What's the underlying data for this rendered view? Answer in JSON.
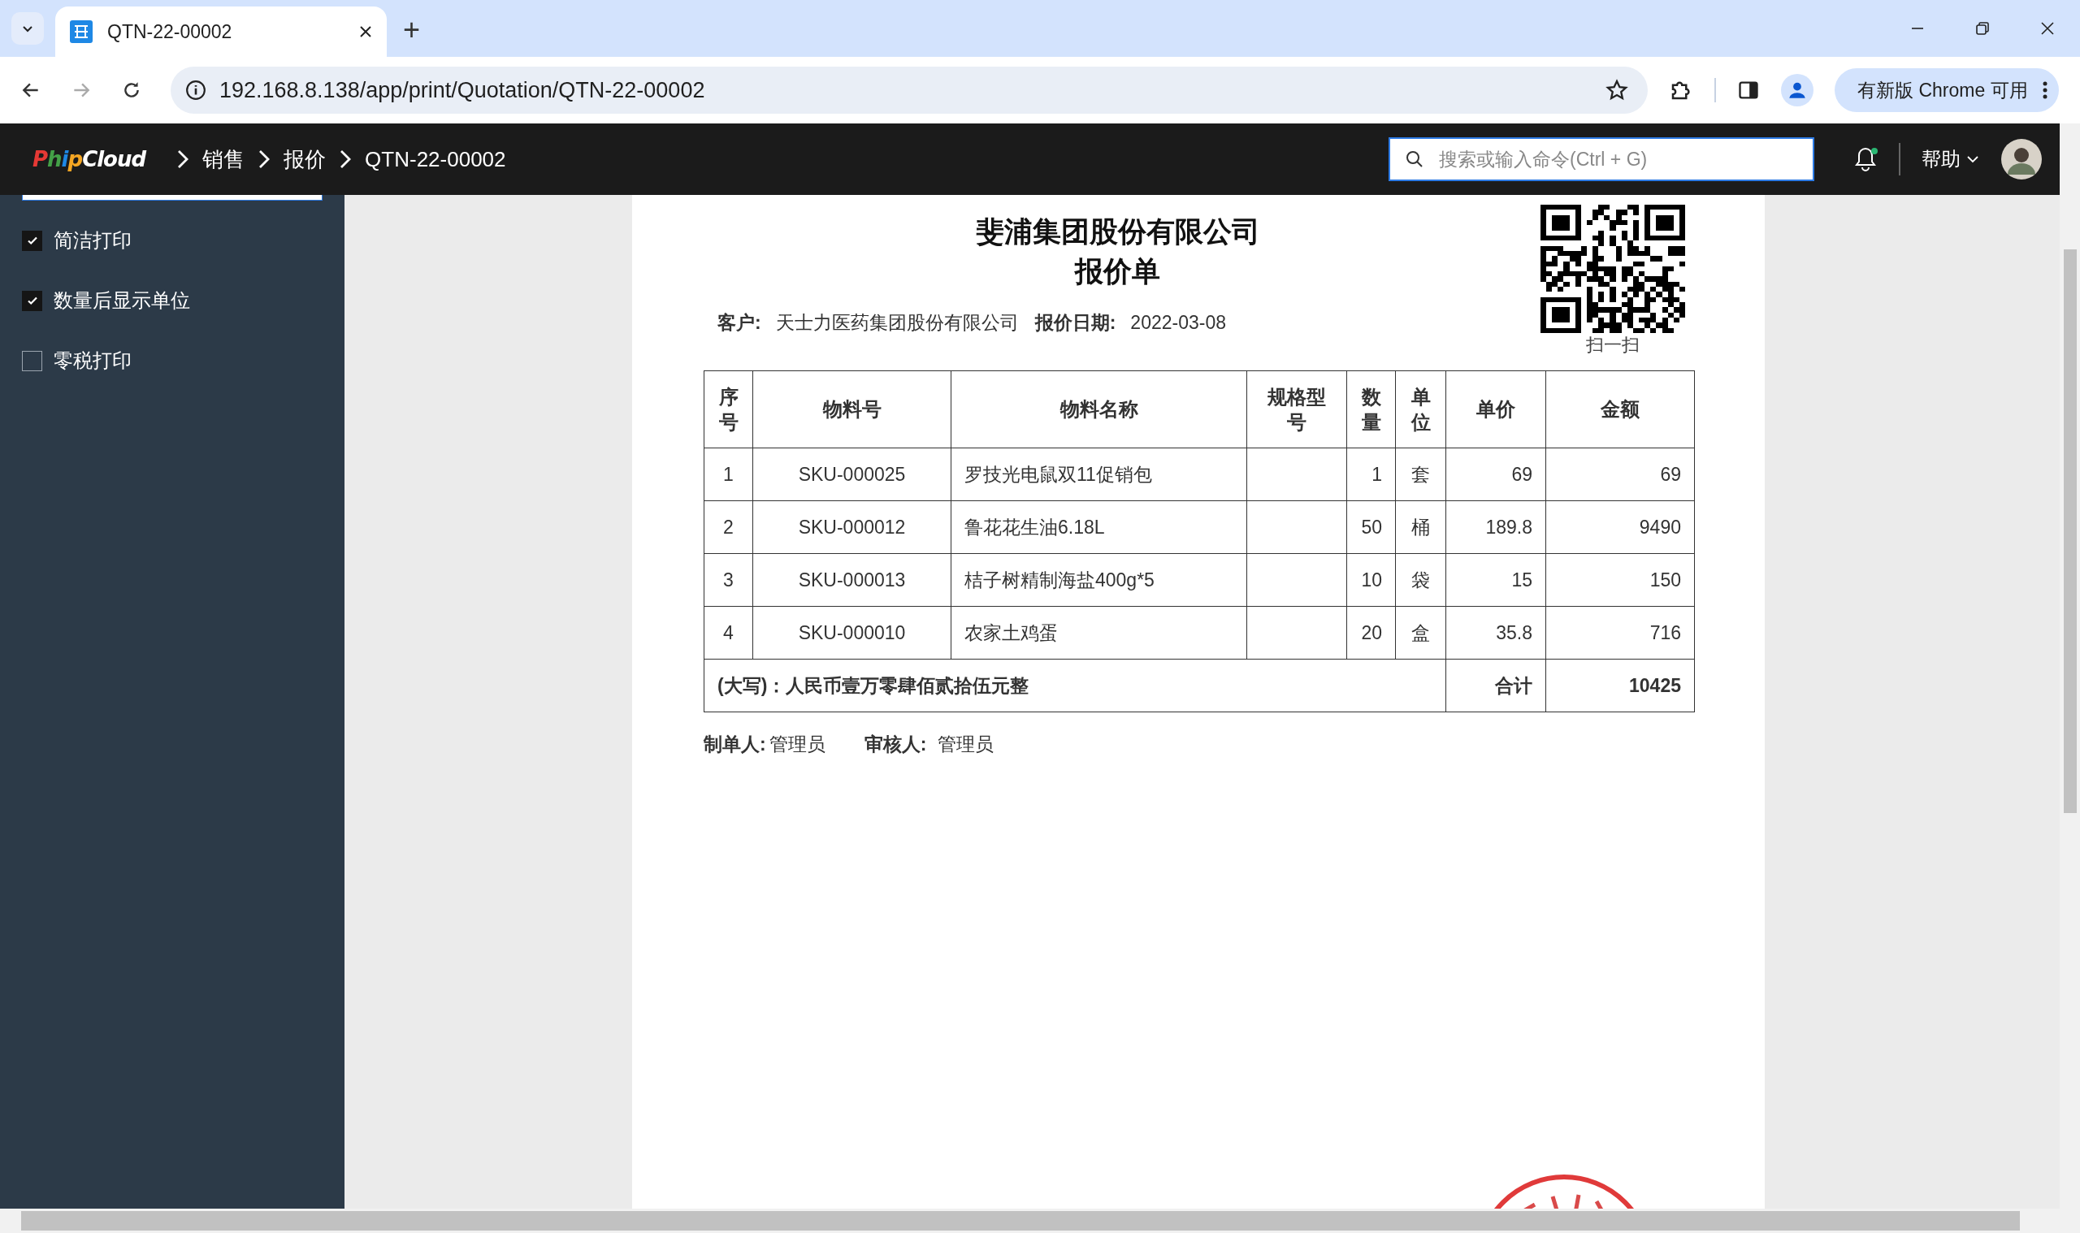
{
  "browser": {
    "tabs": [
      {
        "title": "QTN-22-00002",
        "selected": true
      }
    ],
    "new_tab": "+",
    "address": "192.168.8.138/app/print/Quotation/QTN-22-00002",
    "update_chip": "有新版 Chrome 可用"
  },
  "app_header": {
    "logo": "PhipCloud",
    "breadcrumbs": [
      "销售",
      "报价",
      "QTN-22-00002"
    ],
    "search": {
      "placeholder": "搜索或输入命令(Ctrl + G)"
    },
    "notifications_unread": true,
    "help": "帮助"
  },
  "sidebar": {
    "options": [
      {
        "label": "简洁打印",
        "checked": true
      },
      {
        "label": "数量后显示单位",
        "checked": true
      },
      {
        "label": "零税打印",
        "checked": false
      }
    ]
  },
  "document": {
    "company": "斐浦集团股份有限公司",
    "title": "报价单",
    "customer_label": "客户:",
    "customer": "天士力医药集团股份有限公司",
    "date_label": "报价日期:",
    "date": "2022-03-08",
    "qr_caption": "扫一扫",
    "table": {
      "columns": [
        "序号",
        "物料号",
        "物料名称",
        "规格型号",
        "数量",
        "单位",
        "单价",
        "金额"
      ],
      "rows": [
        [
          "1",
          "SKU-000025",
          "罗技光电鼠双11促销包",
          "",
          "1",
          "套",
          "69",
          "69"
        ],
        [
          "2",
          "SKU-000012",
          "鲁花花生油6.18L",
          "",
          "50",
          "桶",
          "189.8",
          "9490"
        ],
        [
          "3",
          "SKU-000013",
          "桔子树精制海盐400g*5",
          "",
          "10",
          "袋",
          "15",
          "150"
        ],
        [
          "4",
          "SKU-000010",
          "农家土鸡蛋",
          "",
          "20",
          "盒",
          "35.8",
          "716"
        ]
      ],
      "amount_in_words": "(大写)：人民币壹万零肆佰贰拾伍元整",
      "total_label": "合计",
      "total": "10425"
    },
    "maker_label": "制单人:",
    "maker": "管理员",
    "reviewer_label": "审核人:",
    "reviewer": "管理员"
  }
}
